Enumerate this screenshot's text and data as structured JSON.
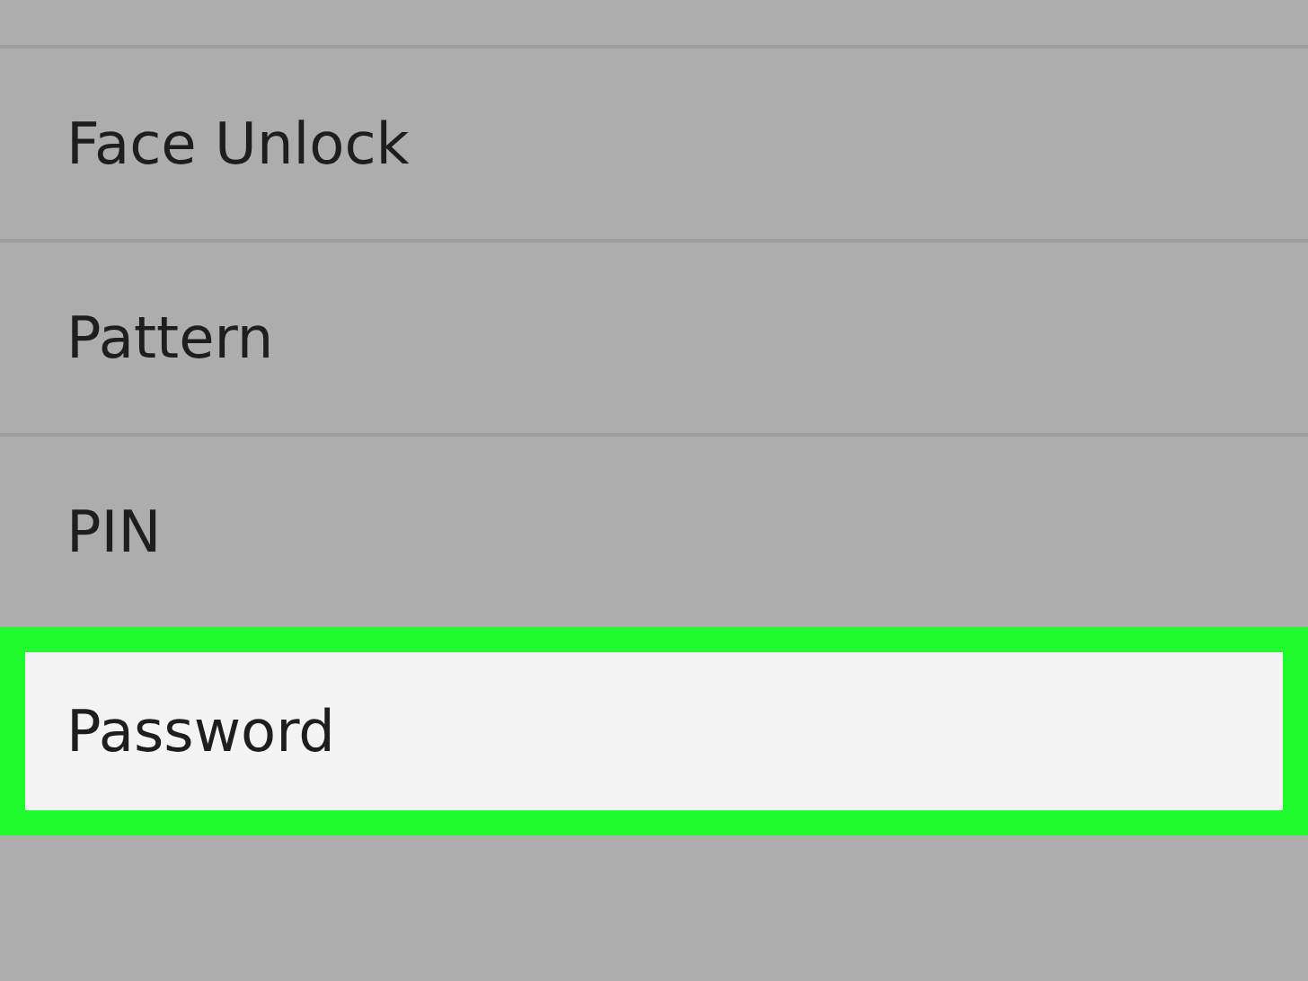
{
  "options": [
    {
      "label": "Face Unlock",
      "selected": false
    },
    {
      "label": "Pattern",
      "selected": false
    },
    {
      "label": "PIN",
      "selected": false
    },
    {
      "label": "Password",
      "selected": true
    }
  ]
}
